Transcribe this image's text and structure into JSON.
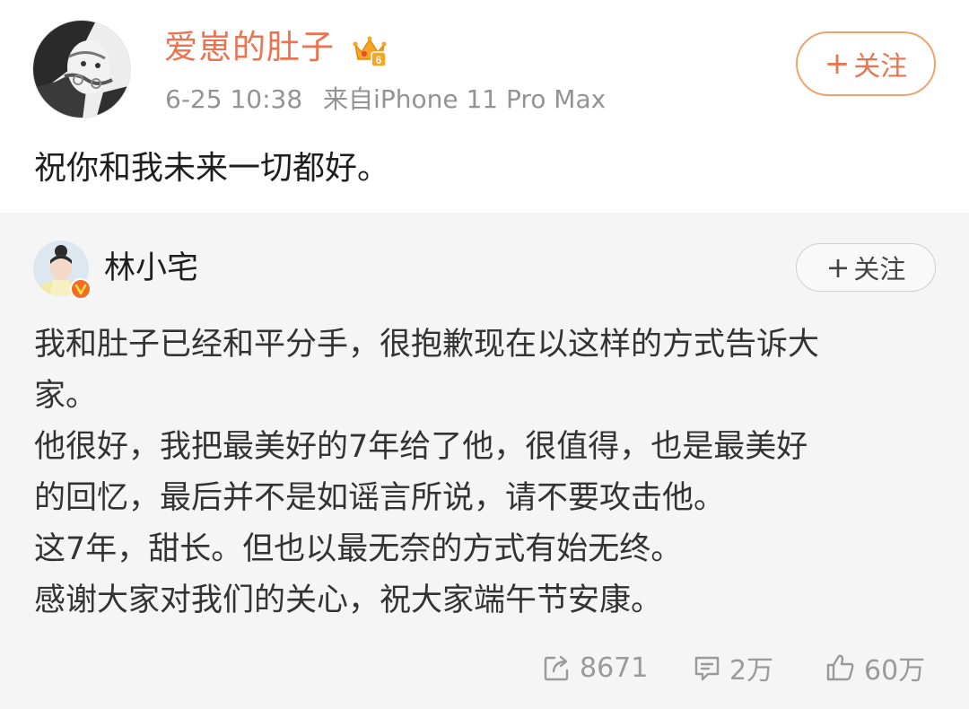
{
  "post": {
    "author_name": "爱崽的肚子",
    "timestamp": "6-25 10:38",
    "source": "来自iPhone 11 Pro Max",
    "follow_label": "关注",
    "text": "祝你和我未来一切都好。",
    "vip_level": "6",
    "avatar_icon": "avatar-photo-icon",
    "badge_icon": "crown-vip-icon"
  },
  "repost": {
    "author_name": "林小宅",
    "follow_label": "关注",
    "verified_icon": "verified-v-icon",
    "lines": [
      "我和肚子已经和平分手，很抱歉现在以这样的方式告诉大",
      "家。",
      "他很好，我把最美好的7年给了他，很值得，也是最美好",
      "的回忆，最后并不是如谣言所说，请不要攻击他。",
      "这7年，甜长。但也以最无奈的方式有始无终。",
      "感谢大家对我们的关心，祝大家端午节安康。"
    ],
    "stats": {
      "reposts": "8671",
      "comments": "2万",
      "likes": "60万"
    }
  },
  "colors": {
    "accent": "#eb7350",
    "follow_border": "#f0a36e",
    "muted": "#939393",
    "repost_bg": "#f5f5f5"
  }
}
